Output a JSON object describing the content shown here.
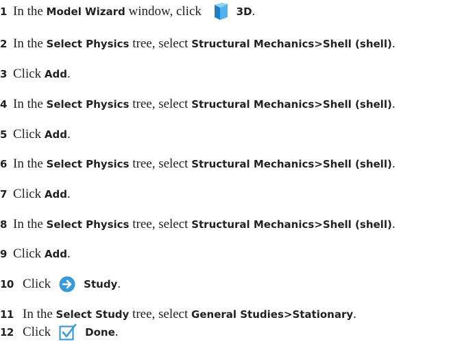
{
  "steps": [
    {
      "num": "1",
      "a": "In the ",
      "ui1": "Model Wizard",
      "b": " window, click ",
      "ui2": "3D",
      "c": "."
    },
    {
      "num": "2",
      "a": "In the ",
      "ui1": "Select Physics",
      "b": " tree, select ",
      "ui2": "Structural Mechanics>Shell (shell)",
      "c": "."
    },
    {
      "num": "3",
      "a": "Click ",
      "ui1": "Add",
      "c": "."
    },
    {
      "num": "4",
      "a": "In the ",
      "ui1": "Select Physics",
      "b": " tree, select ",
      "ui2": "Structural Mechanics>Shell (shell)",
      "c": "."
    },
    {
      "num": "5",
      "a": "Click ",
      "ui1": "Add",
      "c": "."
    },
    {
      "num": "6",
      "a": "In the ",
      "ui1": "Select Physics",
      "b": " tree, select ",
      "ui2": "Structural Mechanics>Shell (shell)",
      "c": "."
    },
    {
      "num": "7",
      "a": "Click ",
      "ui1": "Add",
      "c": "."
    },
    {
      "num": "8",
      "a": "In the ",
      "ui1": "Select Physics",
      "b": " tree, select ",
      "ui2": "Structural Mechanics>Shell (shell)",
      "c": "."
    },
    {
      "num": "9",
      "a": "Click ",
      "ui1": "Add",
      "c": "."
    },
    {
      "num": "10",
      "a": "Click",
      "ui1": "Study",
      "c": "."
    },
    {
      "num": "11",
      "a": "In the ",
      "ui1": "Select Study",
      "b": " tree, select ",
      "ui2": "General Studies>Stationary",
      "c": "."
    },
    {
      "num": "12",
      "a": "Click",
      "ui1": "Done",
      "c": "."
    }
  ],
  "icons": {
    "cube": "cube-3d-icon",
    "arrow": "arrow-right-circle-icon",
    "check": "checkbox-done-icon",
    "accent": "#3a9ad9"
  }
}
